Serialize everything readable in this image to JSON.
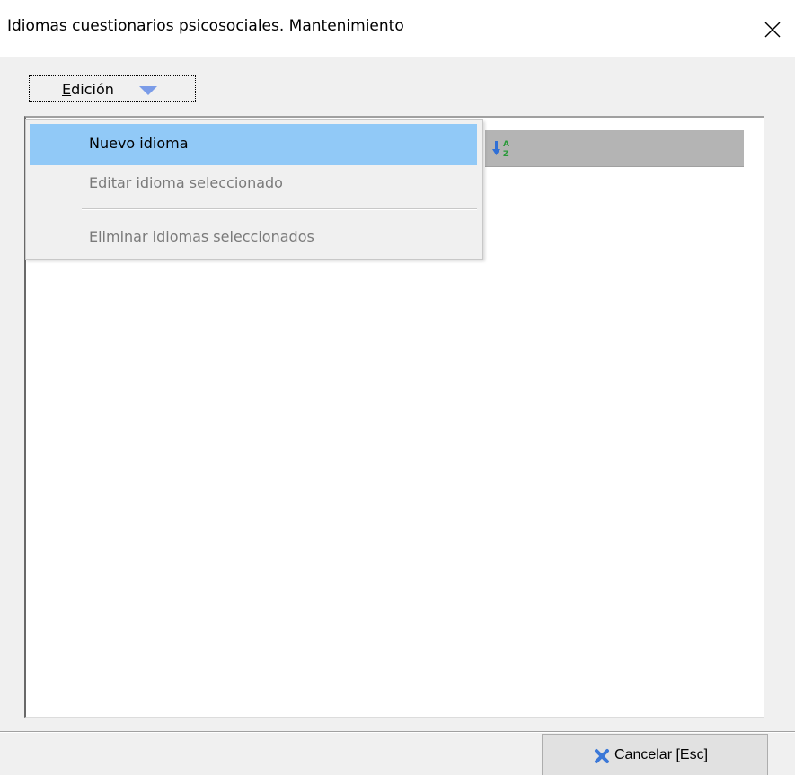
{
  "window": {
    "title": "Idiomas cuestionarios psicosociales. Mantenimiento"
  },
  "toolbar": {
    "edicion_label": "Edición"
  },
  "menu": {
    "items": [
      {
        "label": "Nuevo idioma",
        "state": "highlighted"
      },
      {
        "label": "Editar idioma seleccionado",
        "state": "disabled"
      },
      {
        "label": "Eliminar idiomas seleccionados",
        "state": "disabled"
      }
    ]
  },
  "footer": {
    "cancel_label": "Cancelar [Esc]"
  },
  "icons": {
    "close": "close-icon",
    "dropdown": "triangle-down-icon",
    "sort": "sort-az-icon",
    "cancel": "x-icon"
  },
  "colors": {
    "menu_highlight": "#91c9f7",
    "grid_header": "#b4b4b4",
    "cancel_icon_blue": "#3b78d8",
    "dropdown_arrow": "#7b9ce8"
  }
}
